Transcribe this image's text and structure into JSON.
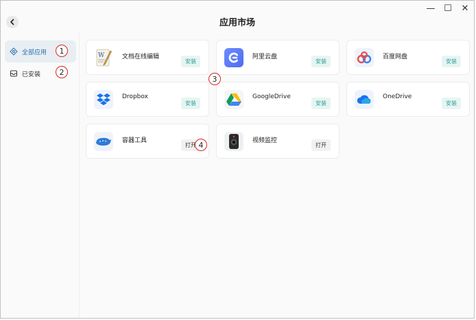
{
  "header": {
    "title": "应用市场",
    "back_icon": "chevron-left-icon",
    "window_controls": [
      {
        "name": "minimize-icon",
        "glyph": "—"
      },
      {
        "name": "maximize-icon",
        "glyph": "☐"
      },
      {
        "name": "close-icon",
        "glyph": "✕"
      }
    ]
  },
  "sidebar": {
    "items": [
      {
        "label": "全部应用",
        "icon": "grid-icon",
        "active": true
      },
      {
        "label": "已安装",
        "icon": "box-icon",
        "active": false
      }
    ]
  },
  "annotations": [
    "1",
    "2",
    "3",
    "4"
  ],
  "apps": [
    {
      "name": "文档在线编辑",
      "action": "安装",
      "icon": "word-doc-icon"
    },
    {
      "name": "阿里云盘",
      "action": "安装",
      "icon": "aliyun-drive-icon"
    },
    {
      "name": "百度网盘",
      "action": "安装",
      "icon": "baidu-netdisk-icon"
    },
    {
      "name": "Dropbox",
      "action": "安装",
      "icon": "dropbox-icon"
    },
    {
      "name": "GoogleDrive",
      "action": "安装",
      "icon": "google-drive-icon"
    },
    {
      "name": "OneDrive",
      "action": "安装",
      "icon": "onedrive-icon"
    },
    {
      "name": "容器工具",
      "action": "打开",
      "icon": "container-whale-icon"
    },
    {
      "name": "视频监控",
      "action": "打开",
      "icon": "camera-icon"
    }
  ],
  "colors": {
    "accent": "#2f6fb0",
    "install_bg": "#e6f5f3",
    "install_text": "#2a9d8f",
    "annotation_ring": "#e02020"
  }
}
